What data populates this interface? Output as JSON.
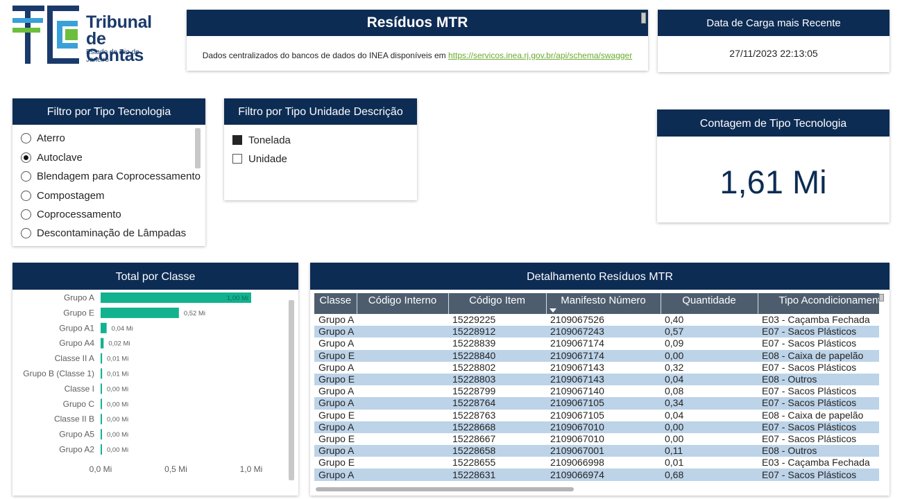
{
  "logo": {
    "line1": "Tribunal",
    "line2": "de Contas",
    "line3": "Estado do Rio de Janeiro"
  },
  "title": {
    "text": "Resíduos MTR",
    "desc": "Dados centralizados do bancos de dados do INEA disponíveis em ",
    "link": "https://servicos.inea.rj.gov.br/api/schema/swagger"
  },
  "date_card": {
    "title": "Data de Carga mais Recente",
    "value": "27/11/2023 22:13:05"
  },
  "filter_tech": {
    "title": "Filtro por Tipo Tecnologia",
    "items": [
      {
        "label": "Aterro",
        "selected": false
      },
      {
        "label": "Autoclave",
        "selected": true
      },
      {
        "label": "Blendagem para Coprocessamento",
        "selected": false
      },
      {
        "label": "Compostagem",
        "selected": false
      },
      {
        "label": "Coprocessamento",
        "selected": false
      },
      {
        "label": "Descontaminação de Lâmpadas",
        "selected": false
      }
    ]
  },
  "filter_unit": {
    "title": "Filtro por Tipo Unidade Descrição",
    "items": [
      {
        "label": "Tonelada",
        "checked": true
      },
      {
        "label": "Unidade",
        "checked": false
      }
    ]
  },
  "count_card": {
    "title": "Contagem de Tipo Tecnologia",
    "value": "1,61 Mi"
  },
  "chart_card": {
    "title": "Total por Classe"
  },
  "chart_data": {
    "type": "bar",
    "orientation": "horizontal",
    "title": "Total por Classe",
    "categories": [
      "Grupo A",
      "Grupo E",
      "Grupo A1",
      "Grupo A4",
      "Classe II A",
      "Grupo B (Classe 1)",
      "Classe I",
      "Grupo C",
      "Classe II B",
      "Grupo A5",
      "Grupo A2"
    ],
    "values": [
      1.0,
      0.52,
      0.04,
      0.02,
      0.01,
      0.01,
      0.0,
      0.0,
      0.0,
      0.0,
      0.0
    ],
    "labels": [
      "1,00 Mi",
      "0,52 Mi",
      "0,04 Mi",
      "0,02 Mi",
      "0,01 Mi",
      "0,01 Mi",
      "0,00 Mi",
      "0,00 Mi",
      "0,00 Mi",
      "0,00 Mi",
      "0,00 Mi"
    ],
    "xlim": [
      0,
      1.0
    ],
    "xticks": [
      0,
      0.5,
      1.0
    ],
    "xtick_labels": [
      "0,0 Mi",
      "0,5 Mi",
      "1,0 Mi"
    ],
    "color": "#12b28f",
    "grid": false
  },
  "table_card": {
    "title": "Detalhamento Resíduos MTR",
    "columns": [
      "Classe",
      "Código Interno",
      "Código Item",
      "Manifesto Número",
      "Quantidade",
      "Tipo Acondicionamento"
    ],
    "rows": [
      [
        "Grupo A",
        "",
        "15229225",
        "2109067526",
        "0,40",
        "E03 - Caçamba Fechada"
      ],
      [
        "Grupo A",
        "",
        "15228912",
        "2109067243",
        "0,57",
        "E07 - Sacos Plásticos"
      ],
      [
        "Grupo A",
        "",
        "15228839",
        "2109067174",
        "0,09",
        "E07 - Sacos Plásticos"
      ],
      [
        "Grupo E",
        "",
        "15228840",
        "2109067174",
        "0,00",
        "E08 - Caixa de papelão"
      ],
      [
        "Grupo A",
        "",
        "15228802",
        "2109067143",
        "0,32",
        "E07 - Sacos Plásticos"
      ],
      [
        "Grupo E",
        "",
        "15228803",
        "2109067143",
        "0,04",
        "E08 - Outros"
      ],
      [
        "Grupo A",
        "",
        "15228799",
        "2109067140",
        "0,08",
        "E07 - Sacos Plásticos"
      ],
      [
        "Grupo A",
        "",
        "15228764",
        "2109067105",
        "0,34",
        "E07 - Sacos Plásticos"
      ],
      [
        "Grupo E",
        "",
        "15228763",
        "2109067105",
        "0,04",
        "E08 - Caixa de papelão"
      ],
      [
        "Grupo A",
        "",
        "15228668",
        "2109067010",
        "0,00",
        "E07 - Sacos Plásticos"
      ],
      [
        "Grupo E",
        "",
        "15228667",
        "2109067010",
        "0,00",
        "E07 - Sacos Plásticos"
      ],
      [
        "Grupo A",
        "",
        "15228658",
        "2109067001",
        "0,11",
        "E08 - Outros"
      ],
      [
        "Grupo E",
        "",
        "15228655",
        "2109066998",
        "0,01",
        "E03 - Caçamba Fechada"
      ],
      [
        "Grupo A",
        "",
        "15228631",
        "2109066974",
        "0,68",
        "E07 - Sacos Plásticos"
      ]
    ]
  }
}
